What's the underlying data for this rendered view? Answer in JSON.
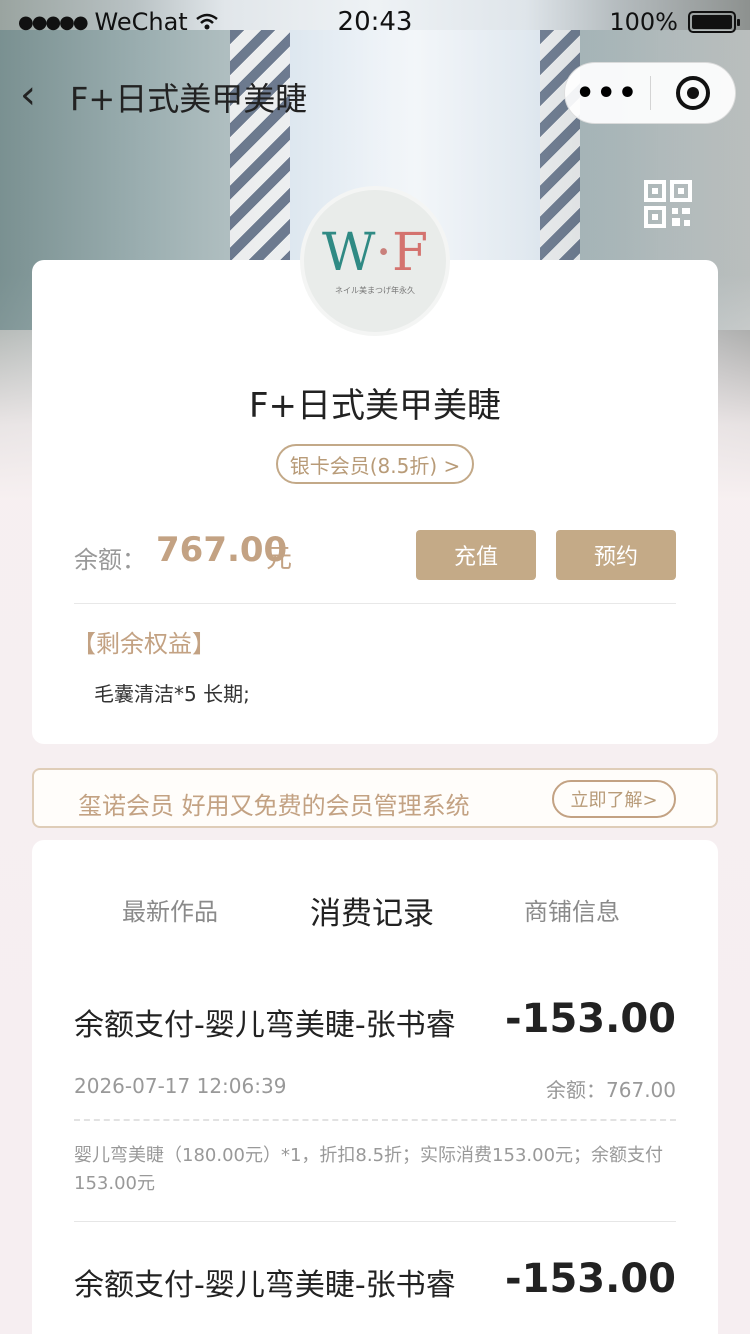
{
  "status_bar": {
    "carrier": "WeChat",
    "time": "20:43",
    "battery": "100%"
  },
  "nav": {
    "title": "F+日式美甲美睫",
    "more": "•••"
  },
  "card": {
    "logo_text": "ネイル美まつげ年永久",
    "shop_name": "F+日式美甲美睫",
    "member_level": "银卡会员(8.5折) >",
    "balance_label": "余额：",
    "balance_value": "767.00",
    "balance_unit": "元",
    "recharge_label": "充值",
    "booking_label": "预约",
    "benefits_title": "【剩余权益】",
    "benefits_items": [
      "毛囊清洁*5 长期;"
    ]
  },
  "promo": {
    "text": "玺诺会员 好用又免费的会员管理系统",
    "button": "立即了解>"
  },
  "tabs": [
    {
      "label": "最新作品"
    },
    {
      "label": "消费记录",
      "active": true
    },
    {
      "label": "商铺信息"
    }
  ],
  "records": [
    {
      "title": "余额支付-婴儿弯美睫-张书睿",
      "amount": "-153.00",
      "date": "2026-07-17 12:06:39",
      "balance": "余额：767.00",
      "detail": "婴儿弯美睫（180.00元）*1，折扣8.5折；实际消费153.00元；余额支付153.00元"
    },
    {
      "title": "余额支付-婴儿弯美睫-张书睿",
      "amount": "-153.00"
    }
  ],
  "colors": {
    "accent": "#c4aa87",
    "accent_text": "#c3a283"
  }
}
